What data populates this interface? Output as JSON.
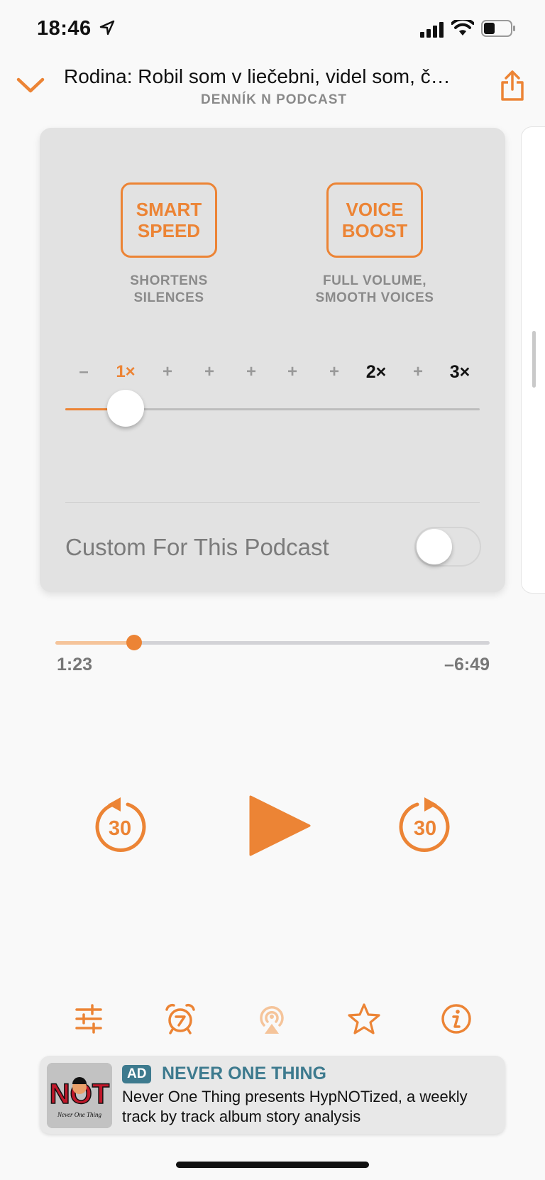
{
  "status_bar": {
    "time": "18:46"
  },
  "header": {
    "title": "Rodina: Robil som v liečebni, videl som, č…",
    "podcast": "DENNÍK N PODCAST"
  },
  "effects": {
    "smart_speed": {
      "line1": "SMART",
      "line2": "SPEED",
      "desc1": "SHORTENS",
      "desc2": "SILENCES"
    },
    "voice_boost": {
      "line1": "VOICE",
      "line2": "BOOST",
      "desc1": "FULL VOLUME,",
      "desc2": "SMOOTH VOICES"
    }
  },
  "speed": {
    "ticks": [
      "–",
      "1×",
      "+",
      "+",
      "+",
      "+",
      "+",
      "2×",
      "+",
      "3×"
    ],
    "current": "1×",
    "level_fraction": 0.14
  },
  "custom": {
    "label": "Custom For This Podcast",
    "enabled": false
  },
  "playback": {
    "elapsed": "1:23",
    "remaining": "–6:49",
    "progress_fraction": 0.17,
    "skip_back_seconds": "30",
    "skip_forward_seconds": "30"
  },
  "ad": {
    "badge": "AD",
    "title": "NEVER ONE THING",
    "description": "Never One Thing presents HypNOTized, a weekly track by track album story analysis",
    "art_text": "NOT",
    "art_caption": "Never One Thing"
  },
  "colors": {
    "accent": "#ec8435",
    "ad_accent": "#3d7a8e"
  },
  "icons": [
    "location-arrow-icon",
    "signal-icon",
    "wifi-icon",
    "battery-icon",
    "chevron-down-icon",
    "share-icon",
    "skip-back-icon",
    "play-icon",
    "skip-forward-icon",
    "effects-icon",
    "sleep-timer-icon",
    "airplay-icon",
    "star-icon",
    "info-icon"
  ]
}
